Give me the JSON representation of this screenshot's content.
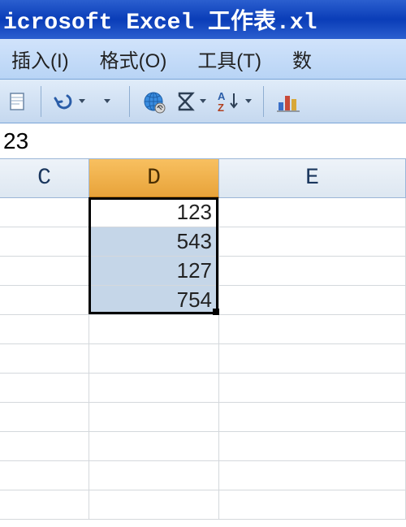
{
  "title": "icrosoft Excel 工作表.xl",
  "menu": {
    "insert": "插入(I)",
    "format": "格式(O)",
    "tools": "工具(T)",
    "data_partial": "数"
  },
  "formula_bar": {
    "value": "23"
  },
  "columns": {
    "c": "C",
    "d": "D",
    "e": "E"
  },
  "chart_data": {
    "type": "table",
    "columns": [
      "C",
      "D",
      "E"
    ],
    "selected_range": "D1:D4",
    "rows": [
      {
        "C": "",
        "D": 123,
        "E": ""
      },
      {
        "C": "",
        "D": 543,
        "E": ""
      },
      {
        "C": "",
        "D": 127,
        "E": ""
      },
      {
        "C": "",
        "D": 754,
        "E": ""
      }
    ]
  },
  "colors": {
    "title_bg": "#1a4fc8",
    "menu_bg": "#c5d9f2",
    "selected_header": "#f0ae4a",
    "selection_fill": "#c5d6e8"
  },
  "layout": {
    "col_c_w": 110,
    "col_d_w": 160,
    "col_e_w": 230
  }
}
